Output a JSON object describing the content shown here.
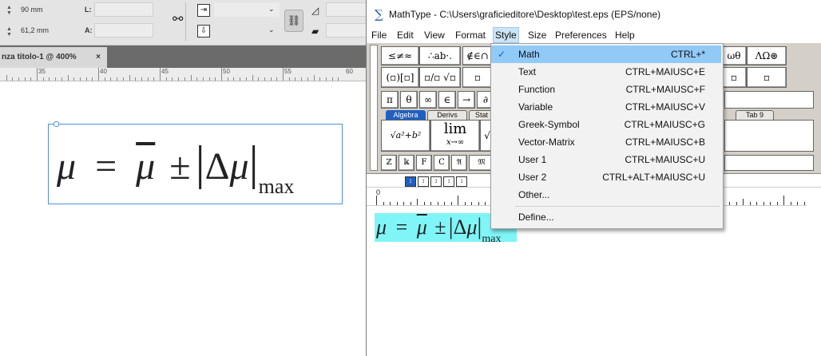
{
  "indesign": {
    "control_panel": {
      "width_value": "90 mm",
      "height_value": "61,2 mm",
      "l_label": "L:",
      "a_label": "A:"
    },
    "document_tab": {
      "title": "nza titolo-1 @ 400%",
      "close_symbol": "×"
    },
    "ruler_labels": [
      "35",
      "40",
      "45",
      "50",
      "55",
      "60"
    ],
    "equation": {
      "mu": "μ",
      "equals": "=",
      "mu_bar": "μ",
      "pm": "±",
      "left_bar": "|",
      "delta": "Δ",
      "mu2": "μ",
      "right_bar": "|",
      "subscript": "max"
    }
  },
  "mathtype": {
    "title_icon": "∑",
    "title": "MathType - C:\\Users\\graficieditore\\Desktop\\test.eps (EPS/none)",
    "menu": [
      "File",
      "Edit",
      "View",
      "Format",
      "Style",
      "Size",
      "Preferences",
      "Help"
    ],
    "active_menu": "Style",
    "palette": {
      "row1": [
        "≤≠≈",
        "∴ab·.",
        "∉∈∩",
        "ωθ",
        "ΛΩ⊛"
      ],
      "row2": [
        "(▫)[▫]",
        "▫/▫ √▫",
        "▫",
        "▫",
        "▫"
      ],
      "row3": [
        "π",
        "θ",
        "∞",
        "∈",
        "→",
        "∂"
      ],
      "tabs": [
        "Algebra",
        "Derivs",
        "Stat",
        "Tab 9"
      ],
      "templates": [
        "√a²+b²",
        "lim",
        "x→∞",
        "√"
      ],
      "row5": [
        "ℤ",
        "𝕜",
        "F",
        "C",
        "𝔄",
        "𝔐"
      ],
      "small_buttons": [
        "↕",
        "↕",
        "↕",
        "↕",
        "↕"
      ]
    },
    "ruler_zero": "0",
    "equation": {
      "mu": "μ",
      "equals": "=",
      "mu_bar": "μ",
      "pm": "±",
      "left_bar": "|",
      "delta": "Δ",
      "mu2": "μ",
      "right_bar": "|",
      "subscript": "max"
    }
  },
  "style_menu": {
    "items": [
      {
        "label": "Math",
        "shortcut": "CTRL+*",
        "checked": "✓"
      },
      {
        "label": "Text",
        "shortcut": "CTRL+MAIUSC+E"
      },
      {
        "label": "Function",
        "shortcut": "CTRL+MAIUSC+F"
      },
      {
        "label": "Variable",
        "shortcut": "CTRL+MAIUSC+V"
      },
      {
        "label": "Greek-Symbol",
        "shortcut": "CTRL+MAIUSC+G"
      },
      {
        "label": "Vector-Matrix",
        "shortcut": "CTRL+MAIUSC+B"
      },
      {
        "label": "User 1",
        "shortcut": "CTRL+MAIUSC+U"
      },
      {
        "label": "User 2",
        "shortcut": "CTRL+ALT+MAIUSC+U"
      },
      {
        "label": "Other...",
        "shortcut": ""
      },
      {
        "label": "Define...",
        "shortcut": ""
      }
    ]
  },
  "colors": {
    "highlight": "#91c9f7",
    "equation_bg": "#7ff5f7",
    "selected_tab": "#1f5fc0"
  }
}
